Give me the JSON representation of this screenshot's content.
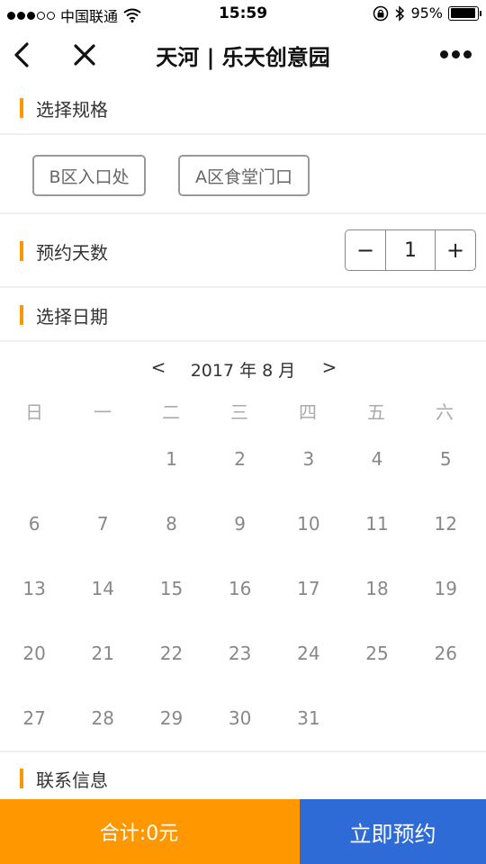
{
  "status_bar": {
    "carrier": "中国联通",
    "time": "15:59",
    "battery": "95%",
    "battery_level": 0.95
  },
  "nav": {
    "title": "天河 | 乐天创意园"
  },
  "spec_section": {
    "label": "选择规格",
    "options": [
      "B区入口处",
      "A区食堂门口"
    ]
  },
  "days_section": {
    "label": "预约天数",
    "minus": "−",
    "value": "1",
    "plus": "+"
  },
  "date_section": {
    "label": "选择日期"
  },
  "calendar": {
    "prev": "<",
    "next": ">",
    "month_label": "2017 年 8 月",
    "weekdays": [
      "日",
      "一",
      "二",
      "三",
      "四",
      "五",
      "六"
    ],
    "days": [
      "",
      "",
      "1",
      "2",
      "3",
      "4",
      "5",
      "6",
      "7",
      "8",
      "9",
      "10",
      "11",
      "12",
      "13",
      "14",
      "15",
      "16",
      "17",
      "18",
      "19",
      "20",
      "21",
      "22",
      "23",
      "24",
      "25",
      "26",
      "27",
      "28",
      "29",
      "30",
      "31",
      "",
      ""
    ]
  },
  "contact_section": {
    "label": "联系信息"
  },
  "bottom": {
    "total": "合计:0元",
    "book": "立即预约"
  },
  "colors": {
    "accent": "#ff9800",
    "primary": "#2f6bd6"
  }
}
